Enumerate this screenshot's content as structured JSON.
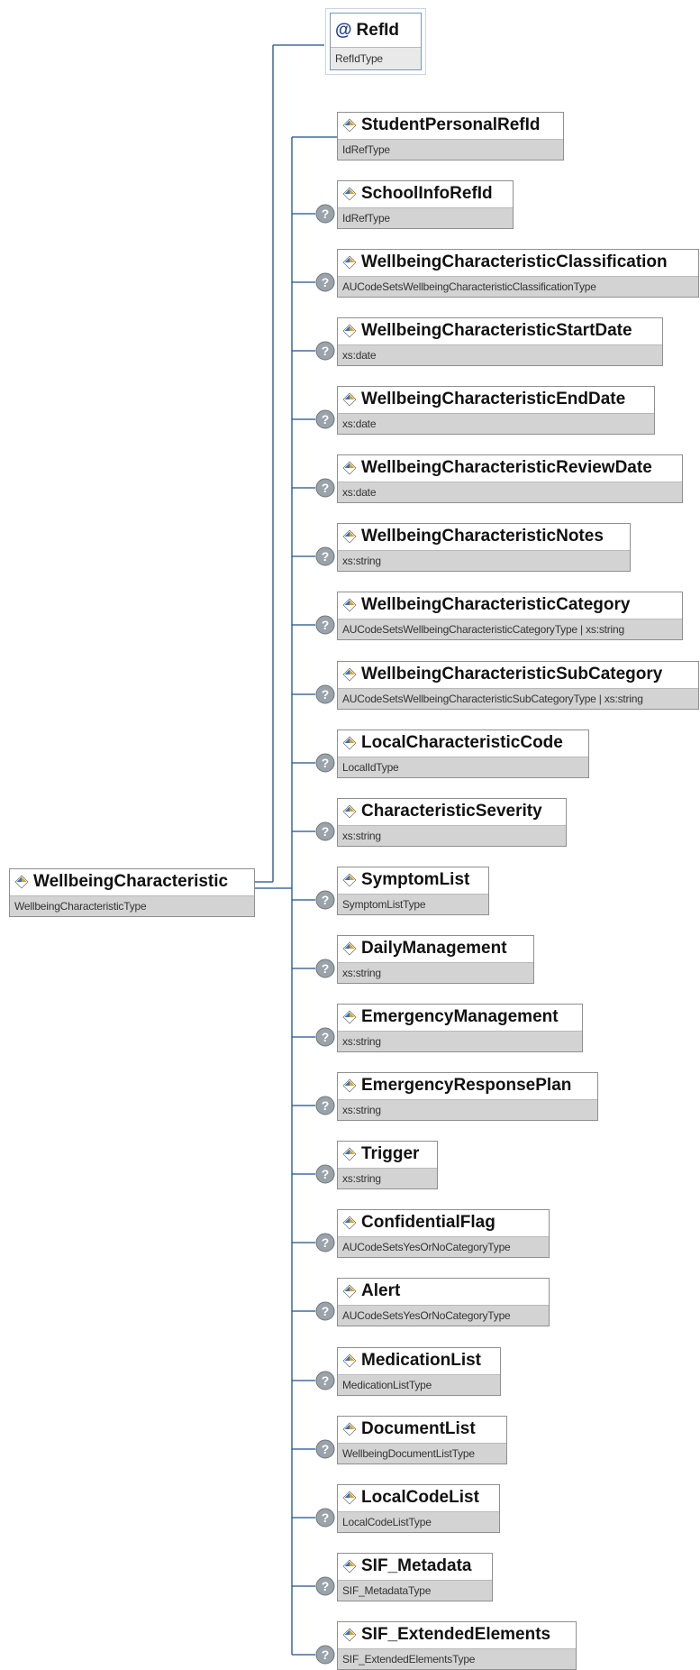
{
  "root": {
    "name": "WellbeingCharacteristic",
    "type": "WellbeingCharacteristicType"
  },
  "attribute": {
    "name": "RefId",
    "type": "RefIdType",
    "symbol": "@"
  },
  "optional_symbol": "?",
  "icons": {
    "element": "element-diamond-icon",
    "attribute": "attribute-at-icon",
    "optional": "question-mark-icon"
  },
  "colors": {
    "connector": "#1e4f8a",
    "type_band": "#d3d3d3",
    "icon_blue": "#2f74c9",
    "icon_gold": "#e3a20b",
    "optional_badge": "#9aa2aa"
  },
  "children": [
    {
      "name": "StudentPersonalRefId",
      "type": "IdRefType"
    },
    {
      "name": "SchoolInfoRefId",
      "type": "IdRefType"
    },
    {
      "name": "WellbeingCharacteristicClassification",
      "type": "AUCodeSetsWellbeingCharacteristicClassificationType"
    },
    {
      "name": "WellbeingCharacteristicStartDate",
      "type": "xs:date"
    },
    {
      "name": "WellbeingCharacteristicEndDate",
      "type": "xs:date"
    },
    {
      "name": "WellbeingCharacteristicReviewDate",
      "type": "xs:date"
    },
    {
      "name": "WellbeingCharacteristicNotes",
      "type": "xs:string"
    },
    {
      "name": "WellbeingCharacteristicCategory",
      "type": "AUCodeSetsWellbeingCharacteristicCategoryType | xs:string"
    },
    {
      "name": "WellbeingCharacteristicSubCategory",
      "type": "AUCodeSetsWellbeingCharacteristicSubCategoryType | xs:string"
    },
    {
      "name": "LocalCharacteristicCode",
      "type": "LocalIdType"
    },
    {
      "name": "CharacteristicSeverity",
      "type": "xs:string"
    },
    {
      "name": "SymptomList",
      "type": "SymptomListType"
    },
    {
      "name": "DailyManagement",
      "type": "xs:string"
    },
    {
      "name": "EmergencyManagement",
      "type": "xs:string"
    },
    {
      "name": "EmergencyResponsePlan",
      "type": "xs:string"
    },
    {
      "name": "Trigger",
      "type": "xs:string"
    },
    {
      "name": "ConfidentialFlag",
      "type": "AUCodeSetsYesOrNoCategoryType"
    },
    {
      "name": "Alert",
      "type": "AUCodeSetsYesOrNoCategoryType"
    },
    {
      "name": "MedicationList",
      "type": "MedicationListType"
    },
    {
      "name": "DocumentList",
      "type": "WellbeingDocumentListType"
    },
    {
      "name": "LocalCodeList",
      "type": "LocalCodeListType"
    },
    {
      "name": "SIF_Metadata",
      "type": "SIF_MetadataType"
    },
    {
      "name": "SIF_ExtendedElements",
      "type": "SIF_ExtendedElementsType"
    }
  ]
}
